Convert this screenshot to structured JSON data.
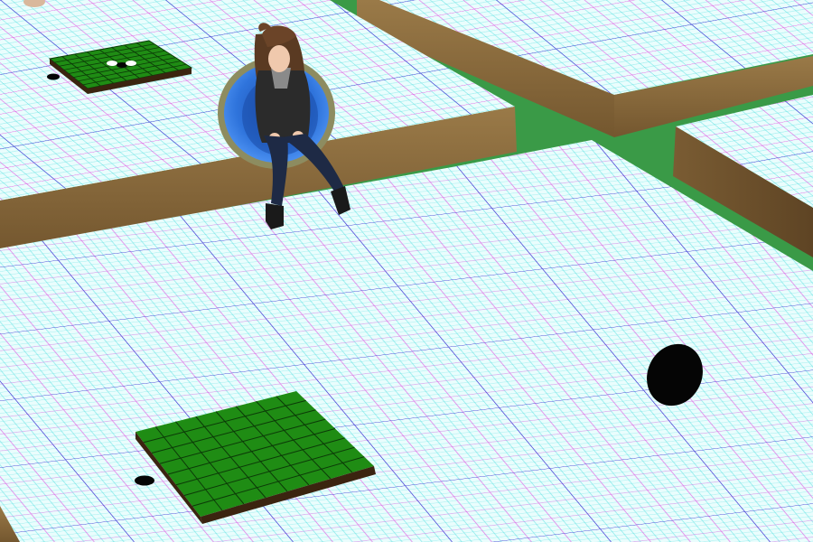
{
  "scene": {
    "kind": "3d-virtual-world",
    "description_visible_text": []
  },
  "colors": {
    "ground": "#3a9a47",
    "grid_base": "#e8fdfd",
    "grid_fine": "#38dede",
    "grid_medium": "#e040e0",
    "grid_major": "#3b3bd6",
    "platform_wood": "#8a6a3c",
    "platform_wood_dark": "#6b4f2a",
    "board_green": "#1e8a12",
    "board_line": "#0c3a08",
    "board_edge": "#3b2410",
    "piece_black": "#050505",
    "piece_white": "#ffffff",
    "chair_shell": "#2f6fd6",
    "chair_rim": "#8a8a5a"
  },
  "objects": {
    "boards": [
      {
        "id": "small-board",
        "cells": 8,
        "pieces": [
          "white",
          "black",
          "white"
        ]
      },
      {
        "id": "large-board",
        "cells": 8,
        "pieces": []
      }
    ],
    "loose_pieces": [
      "black",
      "black",
      "black-large"
    ],
    "avatar": {
      "pose": "sitting",
      "seat": "blue-egg-chair"
    }
  }
}
